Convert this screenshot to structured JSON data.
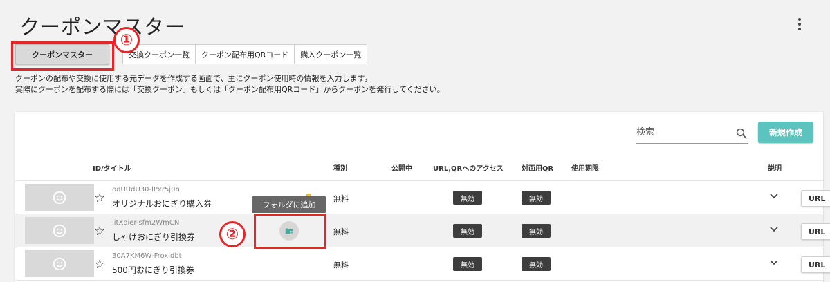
{
  "page": {
    "title": "クーポンマスター"
  },
  "tabs": [
    {
      "label": "クーポンマスター",
      "active": true
    },
    {
      "label": "交換クーポン一覧",
      "active": false
    },
    {
      "label": "クーポン配布用QRコード",
      "active": false
    },
    {
      "label": "購入クーポン一覧",
      "active": false
    }
  ],
  "description": {
    "line1": "クーポンの配布や交換に使用する元データを作成する画面で、主にクーポン使用時の情報を入力します。",
    "line2": "実際にクーポンを配布する際には「交換クーポン」もしくは「クーポン配布用QRコード」からクーポンを発行してください。"
  },
  "toolbar": {
    "search_placeholder": "検索",
    "new_button": "新規作成"
  },
  "table": {
    "headers": {
      "id_title": "ID/タイトル",
      "type": "種別",
      "published": "公開中",
      "url_access": "URL,QRへのアクセス",
      "face_qr": "対面用QR",
      "expiry": "使用期限",
      "explain": "説明"
    },
    "rows": [
      {
        "id": "odUUdU30-lPxr5j0n",
        "title": "オリジナルおにぎり購入券",
        "type": "無料",
        "url_access": "無効",
        "face_qr": "無効",
        "url_button": "URL"
      },
      {
        "id": "litXoier-sfm2WmCN",
        "title": "しゃけおにぎり引換券",
        "type": "無料",
        "url_access": "無効",
        "face_qr": "無効",
        "url_button": "URL"
      },
      {
        "id": "30A7KM6W-Froxldbt",
        "title": "500円おにぎり引換券",
        "type": "無料",
        "url_access": "無効",
        "face_qr": "無効",
        "url_button": "URL"
      }
    ]
  },
  "tooltip": {
    "text": "フォルダに追加"
  },
  "annotations": {
    "callout1": "①",
    "callout2": "②",
    "highlight_color": "#e5252a"
  },
  "colors": {
    "accent": "#5bc4bf",
    "badge": "#3d3d3d"
  }
}
